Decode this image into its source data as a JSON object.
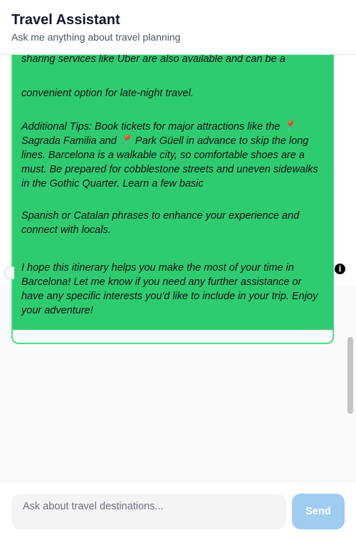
{
  "header": {
    "title": "Travel Assistant",
    "subtitle": "Ask me anything about travel planning"
  },
  "chat": {
    "assistant_message": {
      "line_top": "sharing services like Uber are also available and can be a",
      "para_1": "convenient option for late-night travel.",
      "para_2": "Additional Tips: Book tickets for major attractions like the 📍\nSagrada Familia and 📍 Park Güell in advance to skip the long\nlines. Barcelona is a walkable city, so comfortable shoes are a\nmust. Be prepared for cobblestone streets and uneven sidewalks\nin the Gothic Quarter. Learn a few basic",
      "para_3": "Spanish or Catalan phrases to enhance your experience and\nconnect with locals.",
      "para_4": "I hope this itinerary helps you make the most of your time in\nBarcelona! Let me know if you need any further assistance or\nhave any specific interests you'd like to include in your trip. Enjoy\nyour adventure!"
    },
    "info_icon": "i"
  },
  "composer": {
    "placeholder": "Ask about travel destinations...",
    "send_label": "Send"
  },
  "colors": {
    "bubble": "#2ecc71",
    "bubble_border": "#4ade80",
    "send_button": "#9ecdf0"
  }
}
